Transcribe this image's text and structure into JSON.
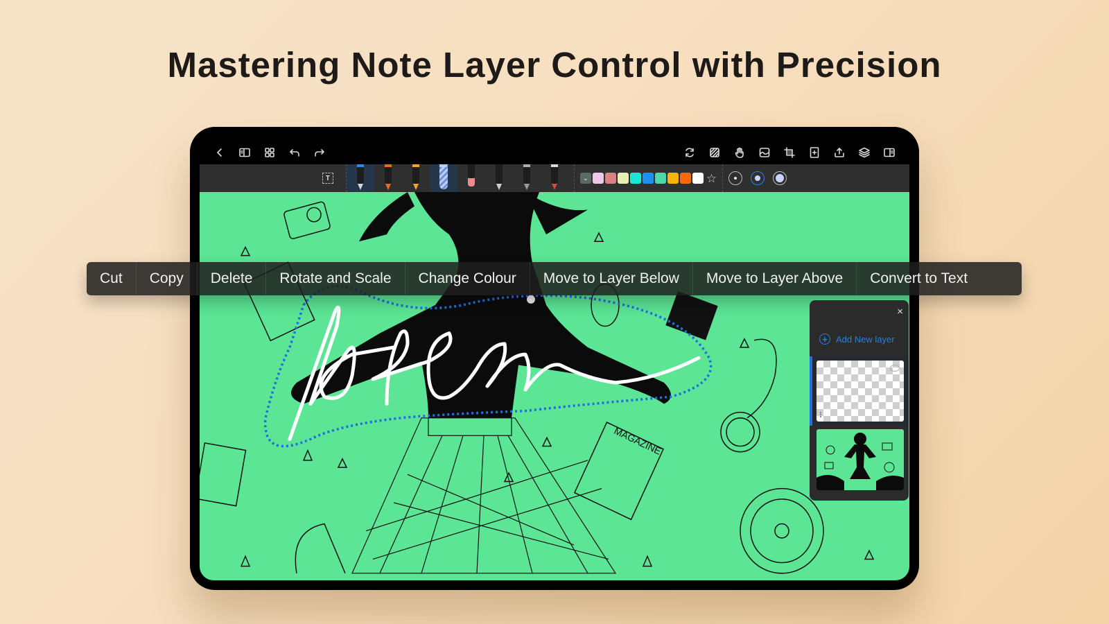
{
  "headline": "Mastering Note Layer Control with Precision",
  "app": {
    "topbar_left": [
      {
        "icon": "back-chevron-icon"
      },
      {
        "icon": "sidebar-panel-icon"
      },
      {
        "icon": "grid-view-icon"
      },
      {
        "icon": "undo-icon"
      },
      {
        "icon": "redo-icon"
      }
    ],
    "topbar_right": [
      {
        "icon": "sync-icon"
      },
      {
        "icon": "hatch-fill-icon"
      },
      {
        "icon": "hand-pan-icon"
      },
      {
        "icon": "image-insert-icon"
      },
      {
        "icon": "crop-icon"
      },
      {
        "icon": "add-page-icon"
      },
      {
        "icon": "share-export-icon"
      },
      {
        "icon": "layers-icon"
      },
      {
        "icon": "reading-mode-icon"
      }
    ],
    "tools": {
      "textbox_label": "T",
      "pens": [
        {
          "name": "fountain-pen",
          "cap": "#2a8cf0",
          "tip": "#cfd7e0",
          "selected": true
        },
        {
          "name": "marker-orange",
          "cap": "#f26a24",
          "tip": "#f26a24",
          "selected": false
        },
        {
          "name": "highlighter-yellow",
          "cap": "#f5a623",
          "tip": "#f5a623",
          "selected": false
        },
        {
          "name": "washi-tape",
          "cap": "#b9cdf5",
          "tip": "#b9cdf5",
          "selected": true
        },
        {
          "name": "eraser",
          "cap": "#1d1d1d",
          "tip": "#ec8a8f",
          "selected": false
        },
        {
          "name": "pencil",
          "cap": "#1d1d1d",
          "tip": "#cfcfcf",
          "selected": false
        },
        {
          "name": "fineliner",
          "cap": "#b0b0b0",
          "tip": "#9a9a9a",
          "selected": false
        },
        {
          "name": "lasso-pen",
          "cap": "#d9d9d9",
          "tip": "#d94545",
          "selected": false
        }
      ],
      "colors": [
        "#ecc9e6",
        "#d88282",
        "#e8efb5",
        "#1ce6d5",
        "#1e8ef0",
        "#4fd6a9",
        "#f5b40a",
        "#f86a10",
        "#ffffff"
      ],
      "color_dropdown_icon": "chevron-down-icon",
      "favorite_icon": "star-icon",
      "stroke_sizes": [
        {
          "label": "small",
          "selected": false
        },
        {
          "label": "medium",
          "selected": true
        },
        {
          "label": "large",
          "selected": false
        }
      ]
    },
    "context_menu": [
      "Cut",
      "Copy",
      "Delete",
      "Rotate and Scale",
      "Change Colour",
      "Move to Layer Below",
      "Move to Layer Above",
      "Convert to Text"
    ],
    "layers_panel": {
      "close_label": "×",
      "add_label": "Add New layer",
      "accent": "#2b7ee0",
      "layers": [
        {
          "name": "handwriting-layer",
          "active": true
        },
        {
          "name": "illustration-layer",
          "active": false
        }
      ]
    },
    "canvas": {
      "background": "#5be595",
      "handwriting": "Notem",
      "selection_color": "#1e6fe0"
    }
  }
}
